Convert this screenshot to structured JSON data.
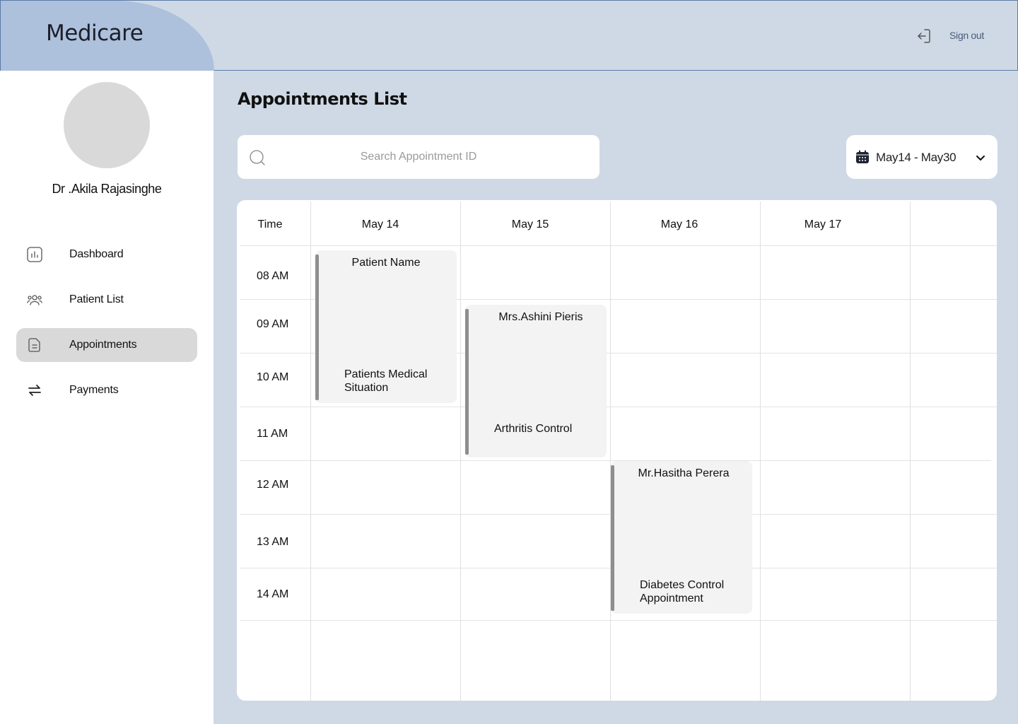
{
  "app": {
    "brand": "Medicare",
    "signout_label": "Sign out"
  },
  "sidebar": {
    "doctor_name": "Dr .Akila Rajasinghe",
    "items": [
      {
        "label": "Dashboard",
        "icon": "chart-icon",
        "active": false
      },
      {
        "label": "Patient List",
        "icon": "users-icon",
        "active": false
      },
      {
        "label": "Appointments",
        "icon": "document-icon",
        "active": true
      },
      {
        "label": "Payments",
        "icon": "transfer-icon",
        "active": false
      }
    ]
  },
  "main": {
    "title": "Appointments List",
    "search": {
      "placeholder": "Search Appointment ID",
      "value": ""
    },
    "date_range": "May14 - May30"
  },
  "calendar": {
    "time_header": "Time",
    "days": [
      "May 14",
      "May 15",
      "May 16",
      "May 17"
    ],
    "times": [
      "08 AM",
      "09 AM",
      "10 AM",
      "11 AM",
      "12 AM",
      "13 AM",
      "14 AM"
    ],
    "appointments": [
      {
        "day": "May 14",
        "start": "08 AM",
        "end": "10 AM",
        "name": "Patient Name",
        "description": "Patients Medical Situation"
      },
      {
        "day": "May 15",
        "start": "09 AM",
        "end": "11 AM",
        "name": "Mrs.Ashini Pieris",
        "description": "Arthritis Control"
      },
      {
        "day": "May 16",
        "start": "12 AM",
        "end": "14 AM",
        "name": "Mr.Hasitha Perera",
        "description": "Diabetes Control Appointment"
      }
    ]
  },
  "colors": {
    "page_bg": "#cfd9e5",
    "brand_bg": "#adc0dc",
    "sidebar_bg": "#ffffff",
    "active_nav_bg": "#d9d9d9",
    "appointment_bg": "#f3f3f3",
    "appointment_bar": "#8e8e8e"
  }
}
